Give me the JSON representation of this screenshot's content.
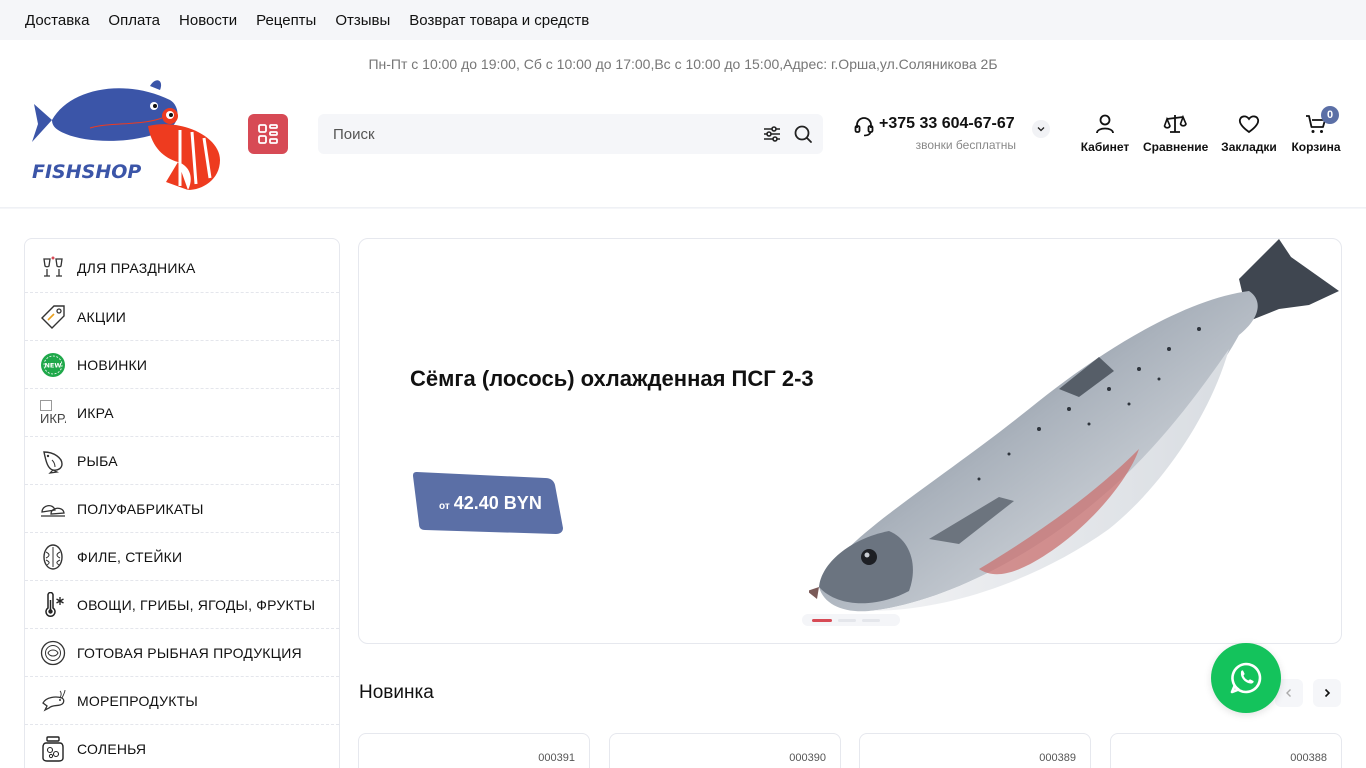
{
  "topnav": {
    "links": [
      "Доставка",
      "Оплата",
      "Новости",
      "Рецепты",
      "Отзывы",
      "Возврат товара и средств"
    ]
  },
  "header": {
    "hours": "Пн-Пт с 10:00 до 19:00, Сб с 10:00 до 17:00,Вс с 10:00 до 15:00,Адрес: г.Орша,ул.Соляникова 2Б",
    "logo_text": "FISHSHOP",
    "search_placeholder": "Поиск",
    "phone": "+375 33 604-67-67",
    "phone_note": "звонки бесплатны",
    "links": {
      "cabinet": "Кабинет",
      "compare": "Сравнение",
      "bookmarks": "Закладки",
      "cart": "Корзина"
    },
    "cart_count": "0",
    "accent": "#d74a55",
    "brand_blue": "#5b6fa6"
  },
  "sidebar": {
    "items": [
      {
        "label": "ДЛЯ ПРАЗДНИКА",
        "icon": "wine-glasses-icon"
      },
      {
        "label": "АКЦИИ",
        "icon": "tag-icon"
      },
      {
        "label": "НОВИНКИ",
        "icon": "new-badge-icon"
      },
      {
        "label": "ИКРА",
        "icon": "broken-image-icon",
        "alt": "ИКРА"
      },
      {
        "label": "РЫБА",
        "icon": "fish-icon"
      },
      {
        "label": "ПОЛУФАБРИКАТЫ",
        "icon": "dumplings-icon"
      },
      {
        "label": "ФИЛЕ, СТЕЙКИ",
        "icon": "fish-steak-icon"
      },
      {
        "label": "ОВОЩИ, ГРИБЫ, ЯГОДЫ, ФРУКТЫ",
        "icon": "thermometer-snow-icon"
      },
      {
        "label": "ГОТОВАЯ РЫБНАЯ ПРОДУКЦИЯ",
        "icon": "plate-icon"
      },
      {
        "label": "МОРЕПРОДУКТЫ",
        "icon": "shrimp-icon"
      },
      {
        "label": "СОЛЕНЬЯ",
        "icon": "jar-icon"
      }
    ]
  },
  "banner": {
    "title": "Сёмга (лосось) охлажденная ПСГ 2-3",
    "price_prefix": "от",
    "price": "42.40 BYN",
    "slide_count": 3,
    "active_slide": 1
  },
  "new_section": {
    "title": "Новинка",
    "cards": [
      {
        "sku": "000391"
      },
      {
        "sku": "000390"
      },
      {
        "sku": "000389"
      },
      {
        "sku": "000388"
      }
    ]
  }
}
